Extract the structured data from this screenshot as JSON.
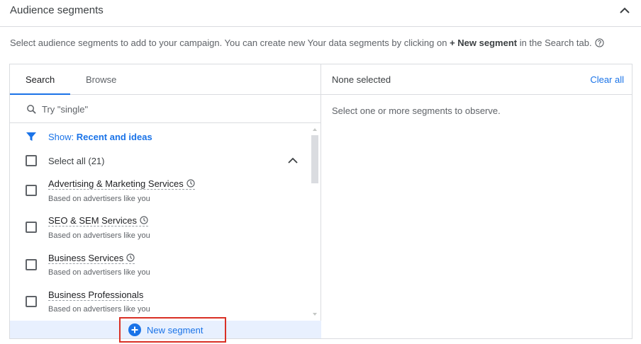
{
  "header": {
    "title": "Audience segments",
    "collapse_icon": "chevron-up-icon"
  },
  "description": {
    "before": "Select audience segments to add to your campaign. You can create new Your data segments by clicking on ",
    "bold": "+ New segment",
    "after": " in the Search tab.",
    "help_icon": "help-circle-icon"
  },
  "left_panel": {
    "tabs": [
      {
        "label": "Search",
        "active": true
      },
      {
        "label": "Browse",
        "active": false
      }
    ],
    "search": {
      "placeholder": "Try \"single\"",
      "value": "",
      "icon": "search-icon"
    },
    "show": {
      "prefix": "Show: ",
      "value": "Recent and ideas",
      "icon": "filter-icon"
    },
    "select_all": {
      "label": "Select all (21)",
      "checked": false,
      "expanded": true
    },
    "items": [
      {
        "name": "Advertising & Marketing Services",
        "sub": "Based on advertisers like you",
        "recent": true,
        "checked": false
      },
      {
        "name": "SEO & SEM Services",
        "sub": "Based on advertisers like you",
        "recent": true,
        "checked": false
      },
      {
        "name": "Business Services",
        "sub": "Based on advertisers like you",
        "recent": true,
        "checked": false
      },
      {
        "name": "Business Professionals",
        "sub": "Based on advertisers like you",
        "recent": false,
        "checked": false
      }
    ],
    "new_segment": {
      "label": "New segment",
      "icon": "plus-circle-icon"
    }
  },
  "right_panel": {
    "status": "None selected",
    "clear_all": "Clear all",
    "empty_message": "Select one or more segments to observe."
  },
  "colors": {
    "accent": "#1a73e8",
    "highlight_border": "#d93025",
    "footer_bg": "#e8f0fe",
    "border": "#dadce0"
  }
}
